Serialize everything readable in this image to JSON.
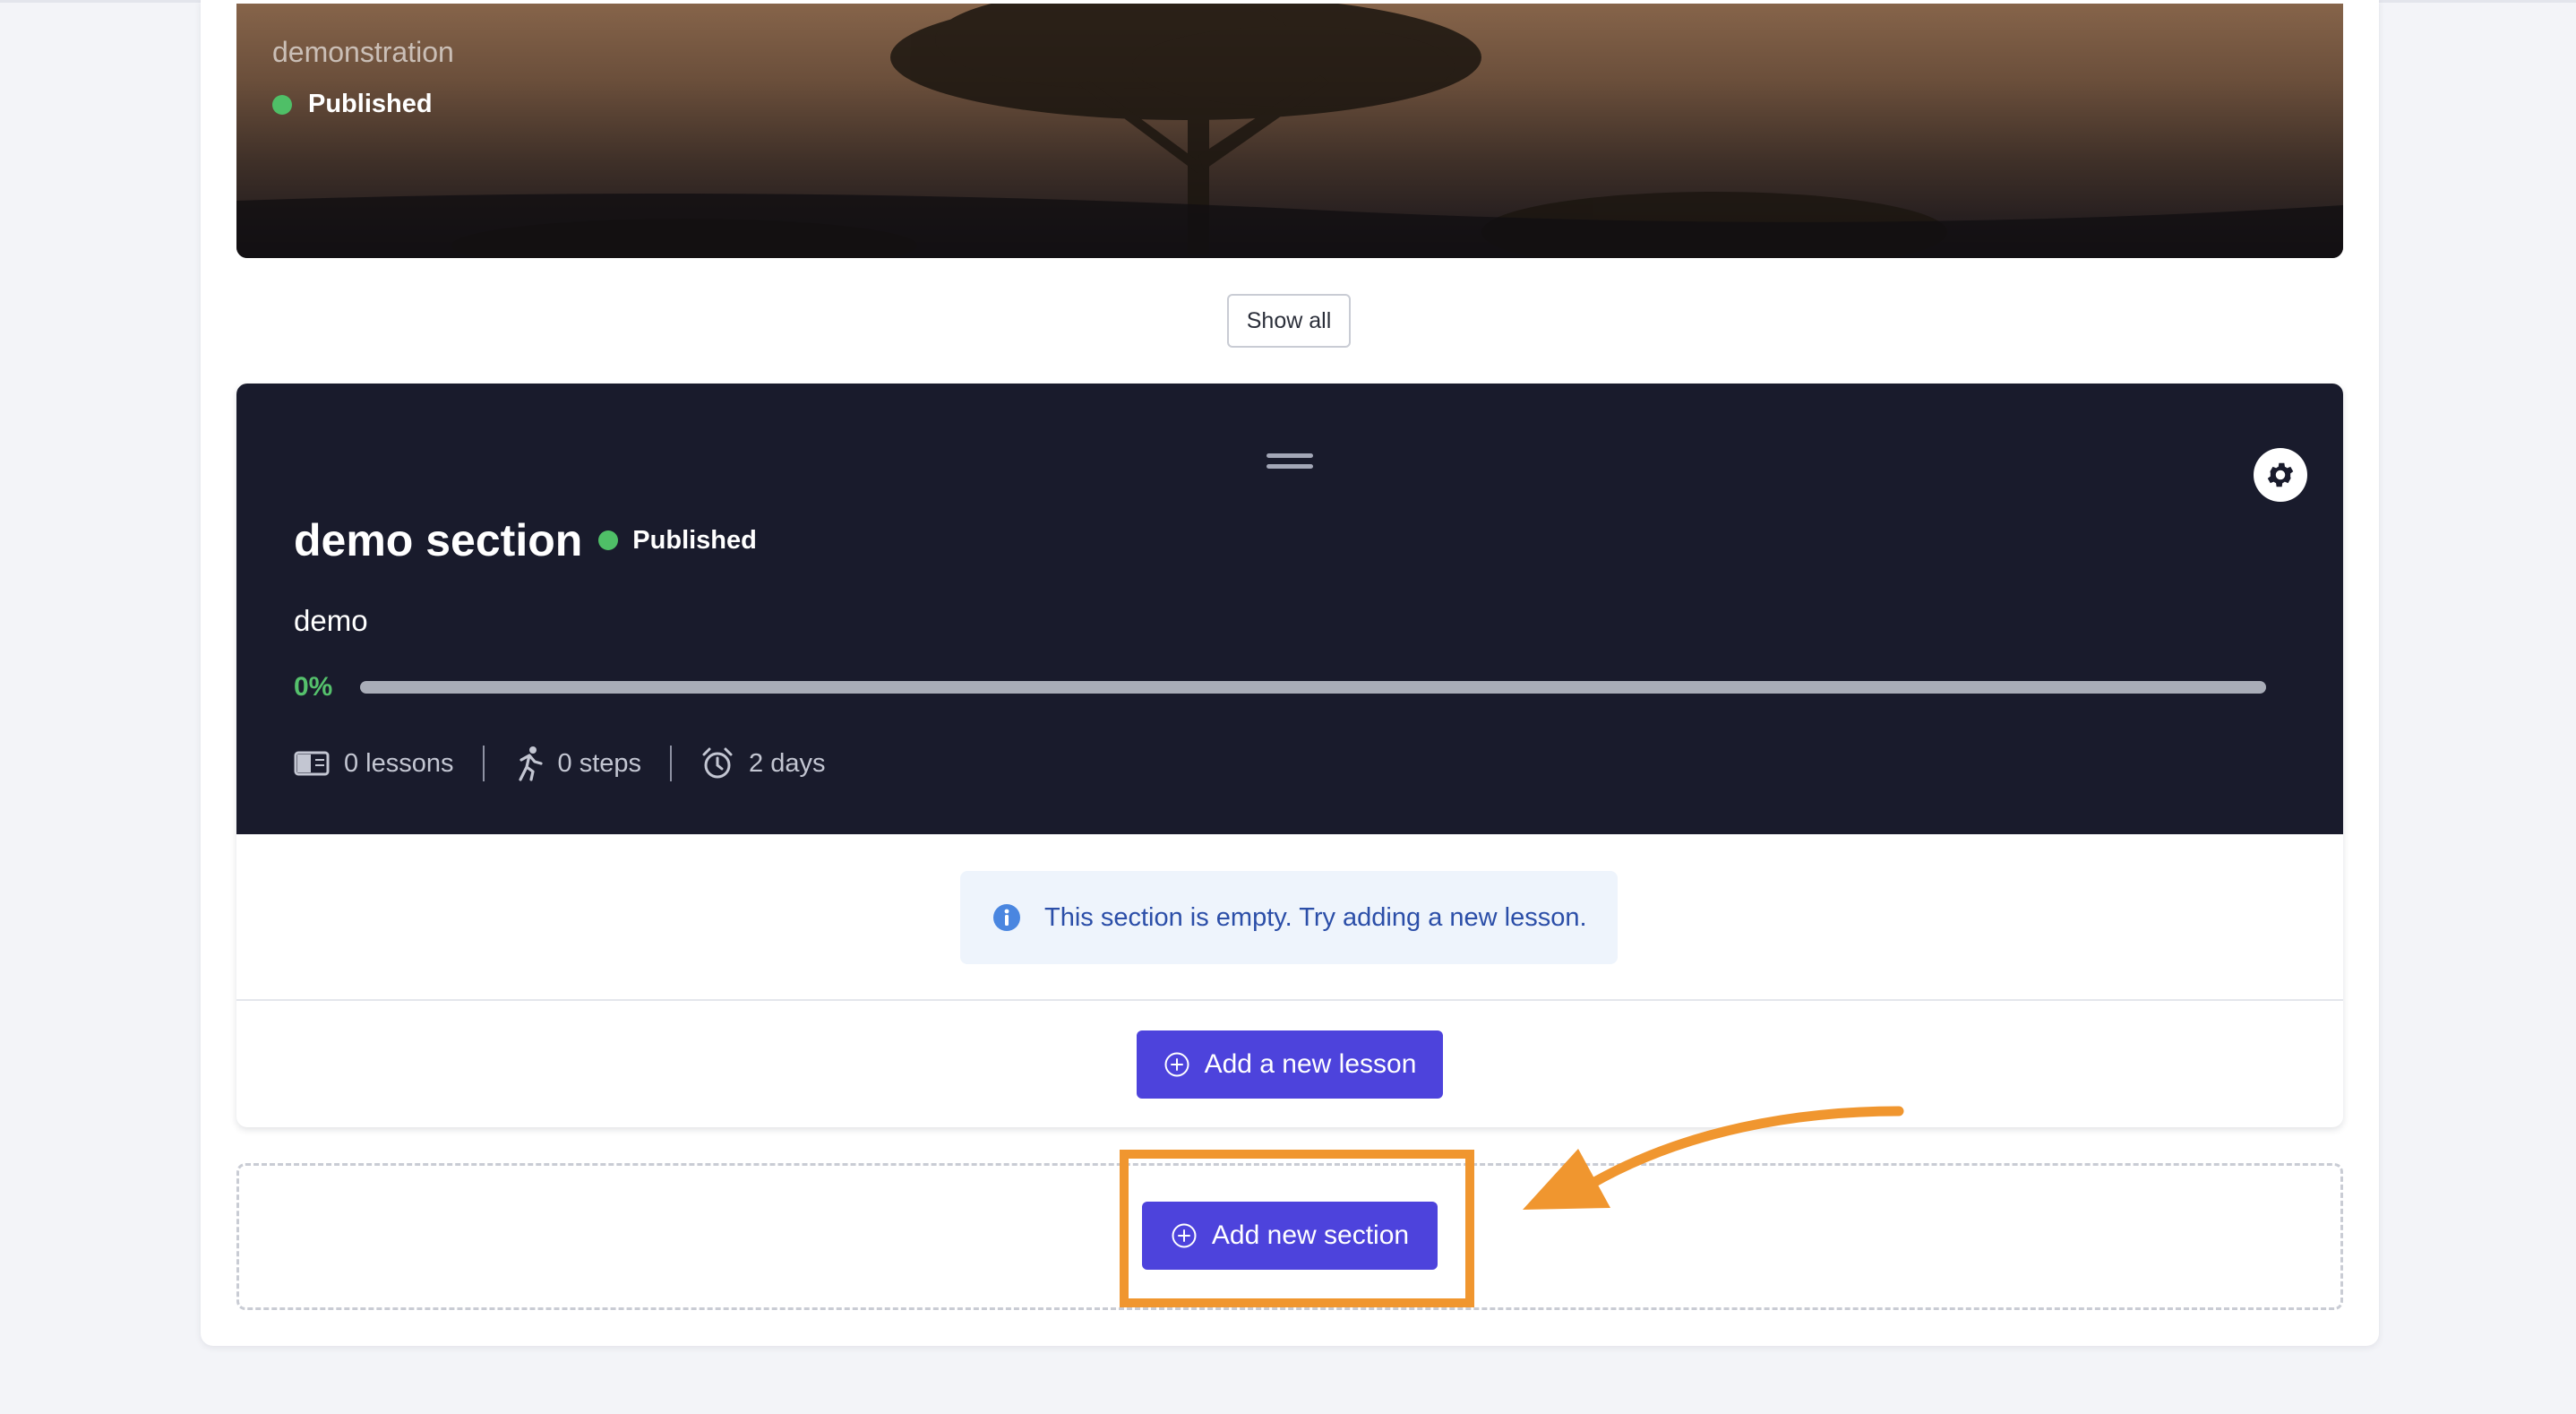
{
  "hero": {
    "subtitle": "demonstration",
    "status": "Published"
  },
  "show_all_label": "Show all",
  "section": {
    "title": "demo section",
    "status": "Published",
    "description": "demo",
    "progress_label": "0%",
    "progress_value": 0,
    "lessons": "0 lessons",
    "steps": "0 steps",
    "duration": "2 days",
    "empty_message": "This section is empty. Try adding a new lesson.",
    "add_lesson_label": "Add a new lesson"
  },
  "add_section_label": "Add new section",
  "colors": {
    "accent": "#4d43dc",
    "published": "#4fbf67",
    "annotation": "#f0962f",
    "section_bg": "#191b2c"
  },
  "icons": [
    "gear-icon",
    "drag-handle-icon",
    "book-icon",
    "running-icon",
    "alarm-clock-icon",
    "info-icon",
    "plus-circle-icon"
  ]
}
